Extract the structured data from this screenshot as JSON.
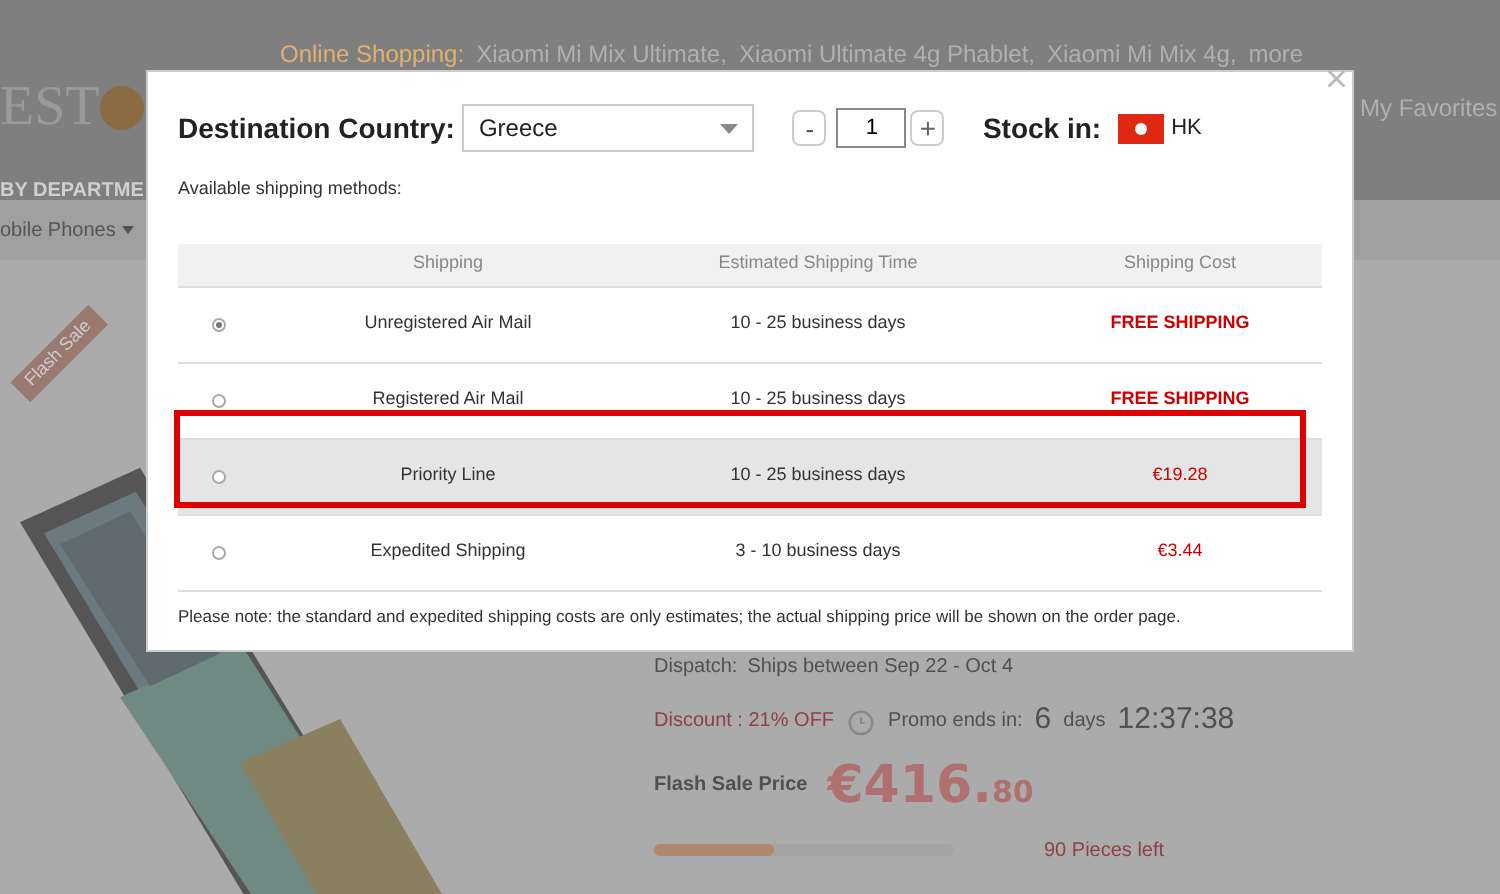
{
  "page": {
    "online_label": "Online Shopping:",
    "online_links": [
      "Xiaomi Mi Mix Ultimate,",
      "Xiaomi Ultimate 4g Phablet,",
      "Xiaomi Mi Mix 4g,",
      "more"
    ],
    "logo_text": "EST",
    "favorites": "My Favorites",
    "department": "BY DEPARTME",
    "breadcrumb": "obile Phones",
    "ribbon": "Flash Sale",
    "dispatch_label": "Dispatch:",
    "dispatch": "Ships between Sep 22 - Oct 4",
    "discount": "Discount : 21% OFF",
    "promo_label": "Promo ends in:",
    "days": "6",
    "days_unit": "days",
    "countdown": "12:37:38",
    "price_label": "Flash Sale Price",
    "price_main": "€416.",
    "price_cents": "80",
    "stock": {
      "level": 0.4
    },
    "pieces_left": "90 Pieces left"
  },
  "dialog": {
    "close": "×",
    "destination_label": "Destination Country:",
    "country": "Greece",
    "minus": "-",
    "quantity": "1",
    "plus": "+",
    "stock_label": "Stock in:",
    "stock_location": "HK",
    "available_label": "Available shipping methods:",
    "columns": [
      "Shipping",
      "Estimated Shipping Time",
      "Shipping Cost"
    ],
    "rows": [
      {
        "selected": true,
        "highlighted": false,
        "method": "Unregistered Air Mail",
        "time": "10 - 25 business days",
        "cost": "FREE SHIPPING",
        "kind": "free"
      },
      {
        "selected": false,
        "highlighted": false,
        "method": "Registered Air Mail",
        "time": "10 - 25 business days",
        "cost": "FREE SHIPPING",
        "kind": "free"
      },
      {
        "selected": false,
        "highlighted": true,
        "method": "Priority Line",
        "time": "10 - 25 business days",
        "cost": "€19.28",
        "kind": "paid"
      },
      {
        "selected": false,
        "highlighted": false,
        "method": "Expedited Shipping",
        "time": "3 - 10 business days",
        "cost": "€3.44",
        "kind": "paid"
      }
    ],
    "note": "Please note: the standard and expedited shipping costs are only estimates; the actual shipping price will be shown on the order page."
  }
}
